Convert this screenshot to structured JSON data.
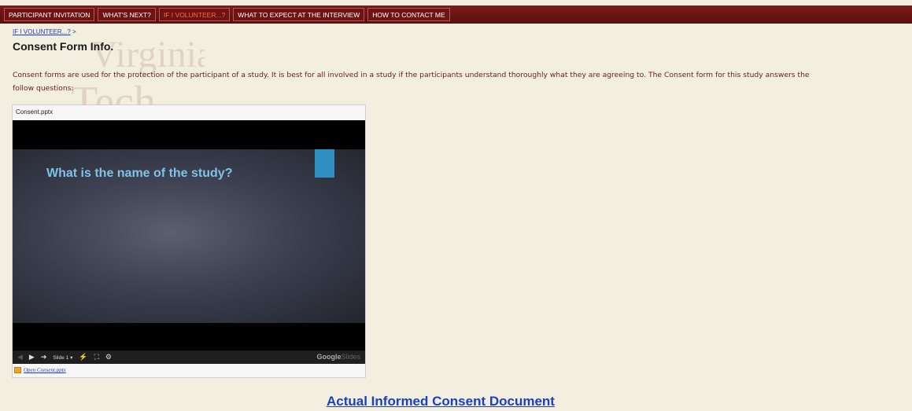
{
  "nav": {
    "tabs": [
      {
        "label": "PARTICIPANT INVITATION",
        "active": false
      },
      {
        "label": "WHAT'S NEXT?",
        "active": false
      },
      {
        "label": "IF I VOLUNTEER...?",
        "active": true
      },
      {
        "label": "WHAT TO EXPECT AT THE INTERVIEW",
        "active": false
      },
      {
        "label": "HOW TO CONTACT ME",
        "active": false
      }
    ],
    "active_color": "#ff6b3d"
  },
  "watermark": {
    "line1": "Virginia",
    "line2": "Tech"
  },
  "breadcrumb": {
    "link": "IF I VOLUNTEER...?",
    "separator": ">"
  },
  "page": {
    "title": "Consent Form Info.",
    "intro_line1": "Consent forms are used for the protection of the participant of a study. It is best for all involved in a study if the participants understand thoroughly what they are agreeing to. The Consent form for this study answers the",
    "intro_line2": "follow questions:"
  },
  "embed": {
    "filename": "Consent.pptx",
    "slide_question": "What is the name of the study?",
    "controls": {
      "slide_label": "Slide 1 ▾",
      "prev_icon": "◀",
      "play_icon": "▶",
      "next_icon": "➔"
    },
    "logo_primary": "Google",
    "logo_secondary": "Slides",
    "open_link": "Open Consent.pptx"
  },
  "document_link": "Actual Informed Consent Document"
}
